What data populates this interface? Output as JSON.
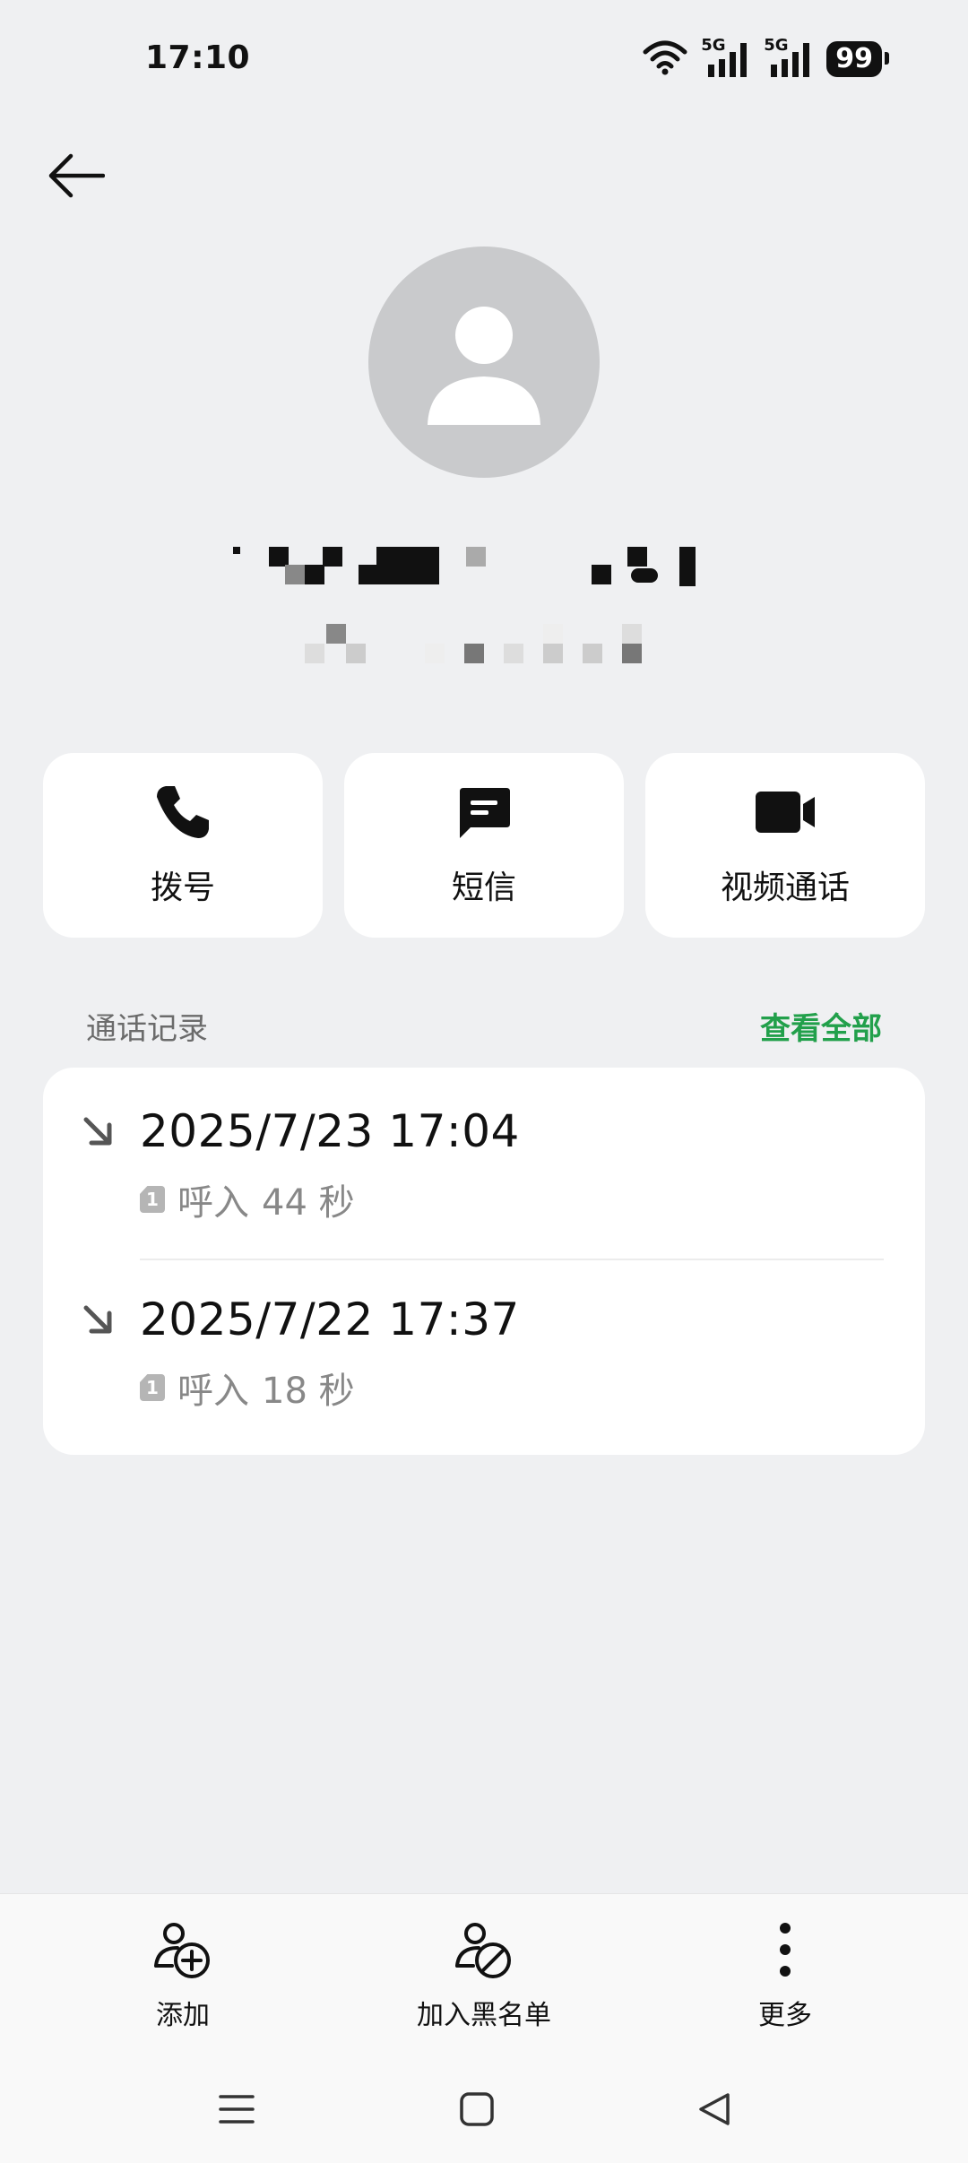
{
  "status_bar": {
    "time": "17:10",
    "sim1": "5G",
    "sim2": "5G",
    "battery": "99"
  },
  "header": {
    "back_icon": "arrow-left-icon"
  },
  "contact": {
    "avatar_icon": "person-icon",
    "name": "",
    "subtitle": ""
  },
  "actions": [
    {
      "label": "拨号",
      "icon": "phone-icon"
    },
    {
      "label": "短信",
      "icon": "message-icon"
    },
    {
      "label": "视频通话",
      "icon": "video-icon"
    }
  ],
  "call_log": {
    "title": "通话记录",
    "view_all": "查看全部",
    "items": [
      {
        "datetime": "2025/7/23 17:04",
        "sim": "1",
        "type": "呼入",
        "duration": "44 秒",
        "icon": "incoming-arrow-icon"
      },
      {
        "datetime": "2025/7/22 17:37",
        "sim": "1",
        "type": "呼入",
        "duration": "18 秒",
        "icon": "incoming-arrow-icon"
      }
    ]
  },
  "bottom_actions": [
    {
      "label": "添加",
      "icon": "add-contact-icon"
    },
    {
      "label": "加入黑名单",
      "icon": "block-contact-icon"
    },
    {
      "label": "更多",
      "icon": "more-icon"
    }
  ],
  "nav": {
    "menu": "menu-icon",
    "home": "home-icon",
    "back": "back-triangle-icon"
  },
  "colors": {
    "accent": "#22a04b",
    "background": "#eff0f2",
    "card": "#ffffff"
  }
}
